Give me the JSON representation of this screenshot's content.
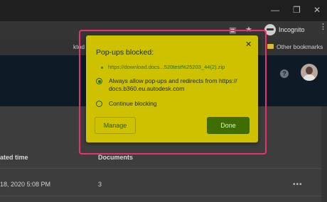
{
  "browser": {
    "incognito_label": "Incognito",
    "bookmarks": {
      "left_fragment": "ktod",
      "other_label": "Other bookmarks"
    }
  },
  "table": {
    "headers": [
      "ated time",
      "Documents"
    ],
    "rows": [
      {
        "time": "18, 2020 5:08 PM",
        "documents": "3"
      }
    ]
  },
  "popup": {
    "title": "Pop-ups blocked:",
    "blocked_url": "https://download.docs...520test%25203_44(2).zip",
    "options": [
      {
        "line1": "Always allow pop-ups and redirects from https://",
        "line2": "docs.b360.eu.autodesk.com",
        "selected": true
      },
      {
        "line1": "Continue blocking",
        "line2": "",
        "selected": false
      }
    ],
    "manage_label": "Manage",
    "done_label": "Done"
  },
  "colors": {
    "popup_bg": "#cdc100",
    "highlight": "#e8326f",
    "done_bg": "#3f6d00",
    "appbar": "#0e1a26"
  }
}
